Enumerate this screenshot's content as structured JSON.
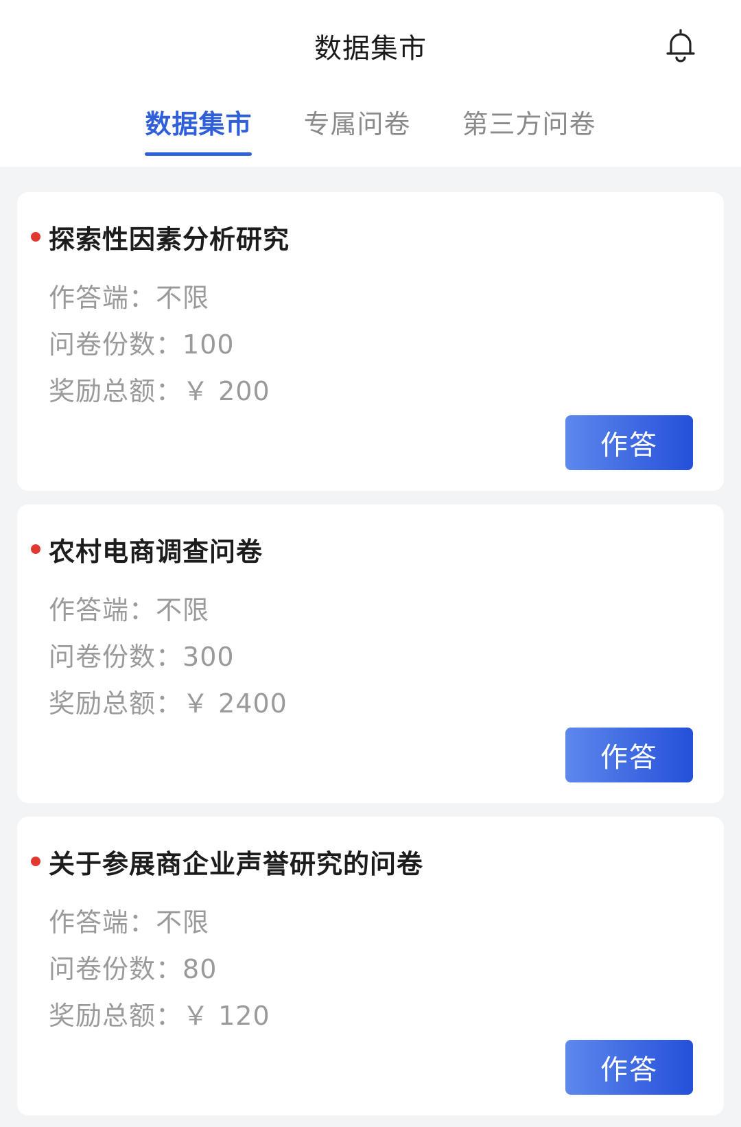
{
  "header": {
    "title": "数据集市",
    "icon": "bell-icon"
  },
  "tabs": [
    {
      "label": "数据集市",
      "active": true
    },
    {
      "label": "专属问卷",
      "active": false
    },
    {
      "label": "第三方问卷",
      "active": false
    }
  ],
  "colors": {
    "accent": "#2f5fd9",
    "dot": "#e3382f"
  },
  "surveys": [
    {
      "title": "探索性因素分析研究",
      "platform_label": "作答端：",
      "platform_value": "不限",
      "count_label": "问卷份数：",
      "count_value": "100",
      "reward_label": "奖励总额：",
      "reward_value": "￥ 200",
      "button_label": "作答"
    },
    {
      "title": "农村电商调查问卷",
      "platform_label": "作答端：",
      "platform_value": "不限",
      "count_label": "问卷份数：",
      "count_value": "300",
      "reward_label": "奖励总额：",
      "reward_value": "￥ 2400",
      "button_label": "作答"
    },
    {
      "title": "关于参展商企业声誉研究的问卷",
      "platform_label": "作答端：",
      "platform_value": "不限",
      "count_label": "问卷份数：",
      "count_value": "80",
      "reward_label": "奖励总额：",
      "reward_value": "￥ 120",
      "button_label": "作答"
    }
  ]
}
